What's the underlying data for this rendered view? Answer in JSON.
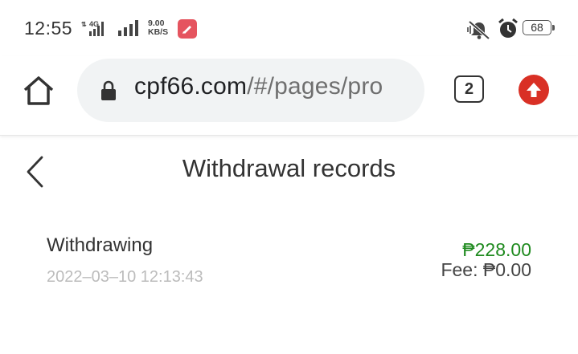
{
  "status_bar": {
    "time": "12:55",
    "network_type": "4G",
    "speed_value": "9.00",
    "speed_unit": "KB/S",
    "battery": "68"
  },
  "browser": {
    "url_domain": "cpf66.com",
    "url_path": "/#/pages/pro",
    "tab_count": "2"
  },
  "page": {
    "title": "Withdrawal records"
  },
  "records": [
    {
      "status": "Withdrawing",
      "date": "2022–03–10 12:13:43",
      "amount": "₱228.00",
      "fee": "Fee: ₱0.00"
    }
  ],
  "colors": {
    "amount": "#1e8a1e",
    "update_button": "#d93025",
    "app_badge": "#e5545f"
  }
}
